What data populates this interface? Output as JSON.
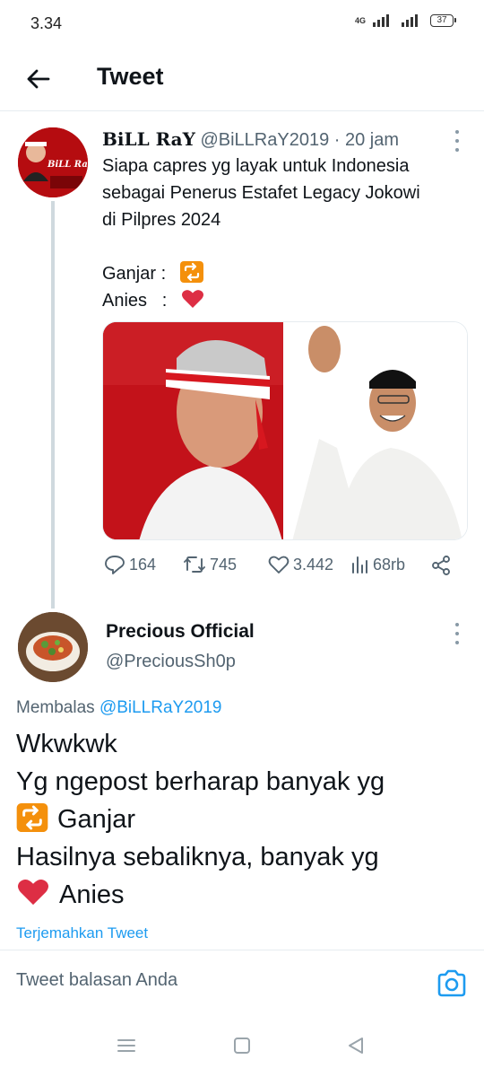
{
  "status_bar": {
    "time": "3.34",
    "network": "4G",
    "battery": "37"
  },
  "header": {
    "title": "Tweet"
  },
  "original_tweet": {
    "display_name": "BiLL RaY",
    "handle": "@BiLLRaY2019",
    "separator": "·",
    "time": "20 jam",
    "text_lines": [
      "Siapa capres yg layak untuk Indonesia",
      "sebagai Penerus Estafet Legacy Jokowi",
      "di Pilpres 2024"
    ],
    "poll_options": [
      {
        "label": "Ganjar :",
        "icon": "retweet-emoji"
      },
      {
        "label": "Anies   :",
        "icon": "heart-emoji"
      }
    ],
    "avatar_text": "BiLL RaY",
    "metrics": {
      "replies": "164",
      "retweets": "745",
      "likes": "3.442",
      "views": "68rb"
    }
  },
  "reply_tweet": {
    "display_name": "Precious Official",
    "handle": "@PreciousSh0p",
    "replying_prefix": "Membalas",
    "replying_to": "@BiLLRaY2019",
    "text_lines": [
      "Wkwkwk",
      "Yg ngepost berharap banyak yg",
      "Ganjar",
      "Hasilnya sebaliknya, banyak yg",
      "Anies"
    ],
    "translate_label": "Terjemahkan Tweet"
  },
  "compose": {
    "placeholder": "Tweet balasan Anda"
  },
  "colors": {
    "accent": "#1d9bf0",
    "muted": "#536471",
    "like_red": "#e0245e",
    "retweet_emoji_bg": "#f4900c"
  }
}
